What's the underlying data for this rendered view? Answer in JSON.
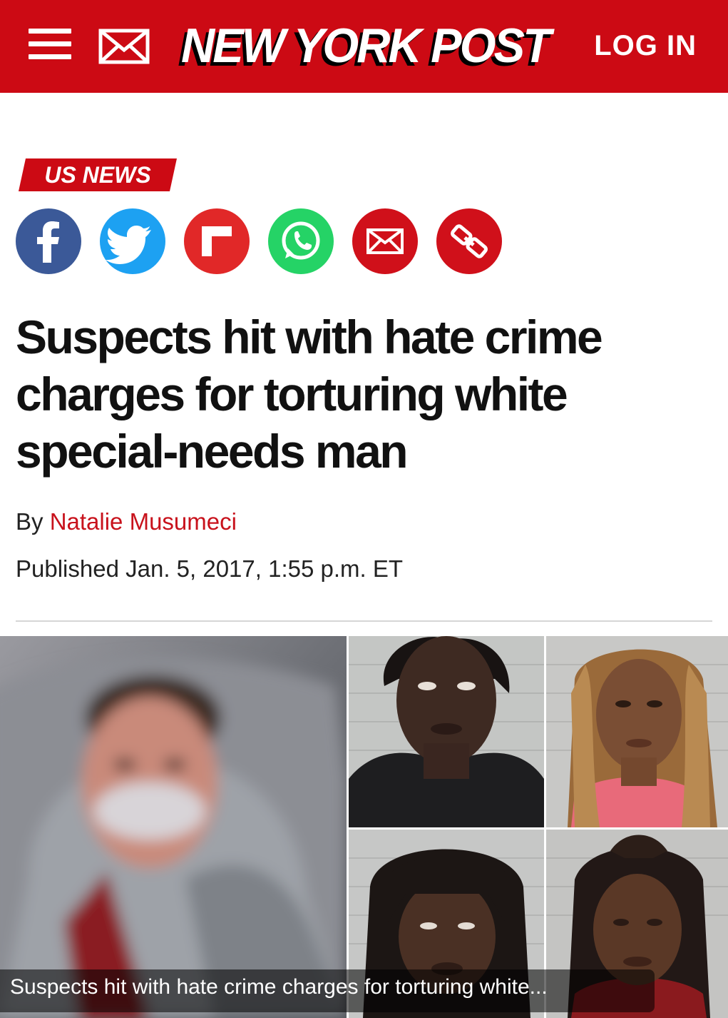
{
  "header": {
    "logo_text": "NEW YORK POST",
    "login_label": "LOG IN",
    "menu_icon": "hamburger-menu-icon",
    "mail_icon": "envelope-icon",
    "brand_color": "#cc0a14"
  },
  "section": {
    "tag": "US NEWS"
  },
  "share": [
    {
      "name": "facebook",
      "icon": "facebook-icon",
      "color": "#3b5998"
    },
    {
      "name": "twitter",
      "icon": "twitter-icon",
      "color": "#1da1f2"
    },
    {
      "name": "flipboard",
      "icon": "flipboard-icon",
      "color": "#e12828"
    },
    {
      "name": "whatsapp",
      "icon": "whatsapp-icon",
      "color": "#25d366"
    },
    {
      "name": "email",
      "icon": "envelope-icon",
      "color": "#d0101a"
    },
    {
      "name": "copy-link",
      "icon": "link-icon",
      "color": "#d0101a"
    }
  ],
  "article": {
    "headline_lines": [
      "Suspects hit with hate crime",
      "charges for torturing white",
      "special-needs man"
    ],
    "by_label": "By",
    "author": "Natalie Musumeci",
    "published": "Published Jan. 5, 2017, 1:55 p.m. ET"
  },
  "media": {
    "caption": "Suspects hit with hate crime charges for torturing white..."
  }
}
